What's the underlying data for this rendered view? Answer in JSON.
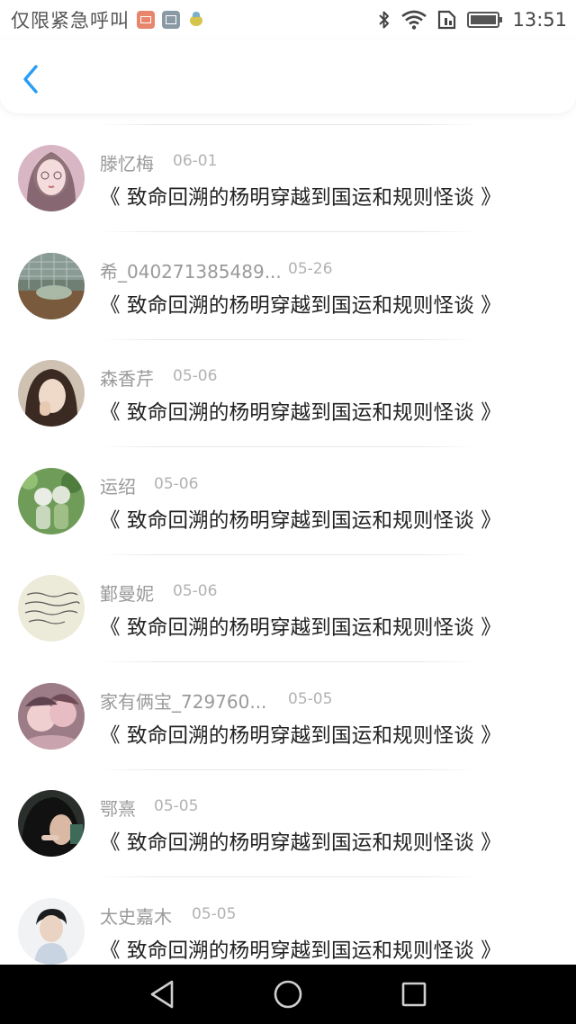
{
  "status_bar": {
    "carrier": "仅限紧急呼叫",
    "time": "13:51",
    "icons": [
      "mail-icon",
      "gallery-icon",
      "baby-app-icon",
      "bluetooth-icon",
      "wifi-icon",
      "sim-icon",
      "battery-icon"
    ]
  },
  "header": {
    "back_icon": "chevron-left-icon",
    "accent_color": "#2a9df4"
  },
  "items": [
    {
      "name": "滕忆梅",
      "date": "06-01",
      "title": "《 致命回溯的杨明穿越到国运和规则怪谈 》"
    },
    {
      "name": "希_040271385489...",
      "date": "05-26",
      "title": "《 致命回溯的杨明穿越到国运和规则怪谈 》"
    },
    {
      "name": "森香芹",
      "date": "05-06",
      "title": "《 致命回溯的杨明穿越到国运和规则怪谈 》"
    },
    {
      "name": "运绍",
      "date": "05-06",
      "title": "《 致命回溯的杨明穿越到国运和规则怪谈 》"
    },
    {
      "name": "鄞曼妮",
      "date": "05-06",
      "title": "《 致命回溯的杨明穿越到国运和规则怪谈 》"
    },
    {
      "name": "家有俩宝_729760...",
      "date": "05-05",
      "title": "《 致命回溯的杨明穿越到国运和规则怪谈 》"
    },
    {
      "name": "鄂熹",
      "date": "05-05",
      "title": "《 致命回溯的杨明穿越到国运和规则怪谈 》"
    },
    {
      "name": "太史嘉木",
      "date": "05-05",
      "title": "《 致命回溯的杨明穿越到国运和规则怪谈 》"
    }
  ],
  "nav_bar": {
    "icons": [
      "back-triangle-icon",
      "home-circle-icon",
      "recents-square-icon"
    ]
  }
}
